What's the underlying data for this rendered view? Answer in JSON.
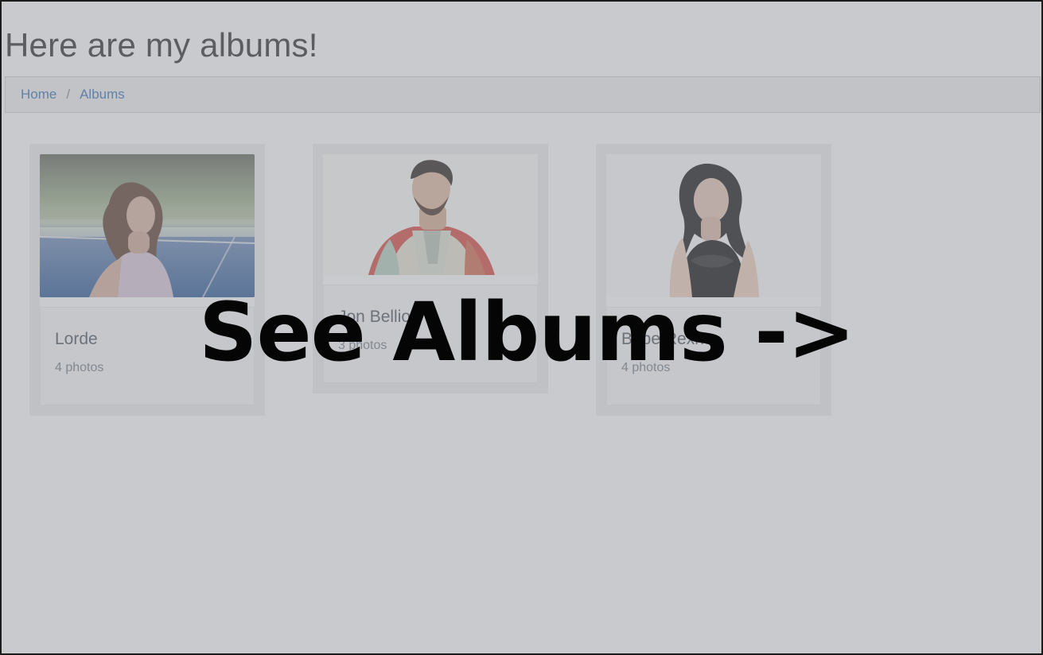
{
  "page": {
    "title": "Here are my albums!"
  },
  "breadcrumb": {
    "items": [
      {
        "label": "Home"
      },
      {
        "label": "Albums"
      }
    ],
    "separator": "/"
  },
  "albums": [
    {
      "name": "Lorde",
      "count": "4 photos"
    },
    {
      "name": "Jon Bellion",
      "count": "3 photos"
    },
    {
      "name": "Bebe Rexha",
      "count": "4 photos"
    }
  ],
  "overlay": {
    "cta": "See Albums ->"
  }
}
